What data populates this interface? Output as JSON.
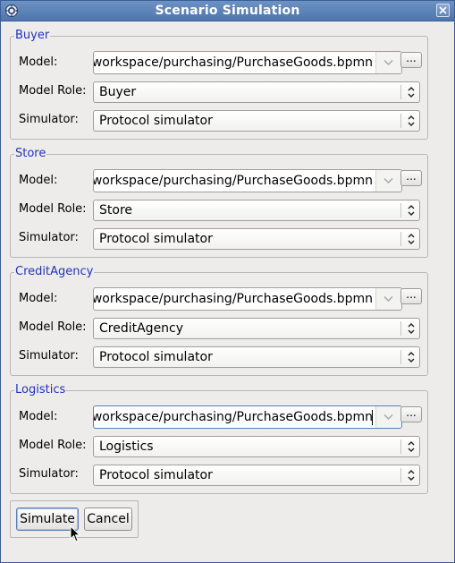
{
  "window": {
    "title": "Scenario Simulation"
  },
  "labels": {
    "model": "Model:",
    "role": "Model Role:",
    "simulator": "Simulator:"
  },
  "browse_label": "...",
  "groups": [
    {
      "title": "Buyer",
      "model_path": "e/workspace/purchasing/PurchaseGoods.bpmn",
      "role": "Buyer",
      "simulator": "Protocol simulator"
    },
    {
      "title": "Store",
      "model_path": "e/workspace/purchasing/PurchaseGoods.bpmn",
      "role": "Store",
      "simulator": "Protocol simulator"
    },
    {
      "title": "CreditAgency",
      "model_path": "e/workspace/purchasing/PurchaseGoods.bpmn",
      "role": "CreditAgency",
      "simulator": "Protocol simulator"
    },
    {
      "title": "Logistics",
      "model_path": "e/workspace/purchasing/PurchaseGoods.bpmn",
      "role": "Logistics",
      "simulator": "Protocol simulator"
    }
  ],
  "buttons": {
    "simulate": "Simulate",
    "cancel": "Cancel"
  }
}
